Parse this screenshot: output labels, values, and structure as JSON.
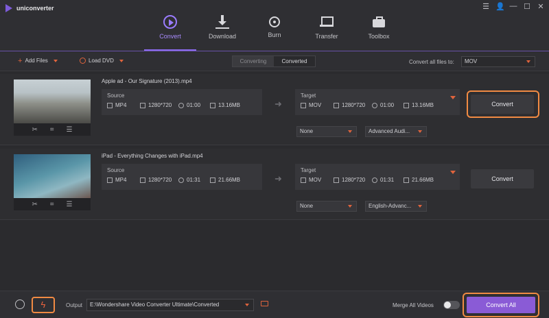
{
  "app": {
    "title": "uniconverter"
  },
  "window_controls": [
    "☰",
    "👤",
    "—",
    "☐",
    "✕"
  ],
  "nav": [
    {
      "label": "Convert",
      "icon": "convert-icon",
      "active": true
    },
    {
      "label": "Download",
      "icon": "download-icon"
    },
    {
      "label": "Burn",
      "icon": "burn-icon"
    },
    {
      "label": "Transfer",
      "icon": "transfer-icon"
    },
    {
      "label": "Toolbox",
      "icon": "toolbox-icon"
    }
  ],
  "toolbar": {
    "add_files": "Add Files",
    "load_dvd": "Load DVD",
    "tab_converting": "Converting",
    "tab_converted": "Converted",
    "convert_all_to_label": "Convert all files to:",
    "convert_all_to_value": "MOV"
  },
  "files": [
    {
      "name": "Apple ad - Our Signature (2013).mp4",
      "source": {
        "title": "Source",
        "format": "MP4",
        "resolution": "1280*720",
        "duration": "01:00",
        "size": "13.16MB"
      },
      "target": {
        "title": "Target",
        "format": "MOV",
        "resolution": "1280*720",
        "duration": "01:00",
        "size": "13.16MB"
      },
      "subtitle": "None",
      "audio": "Advanced Audi...",
      "convert_label": "Convert"
    },
    {
      "name": "iPad - Everything Changes with iPad.mp4",
      "source": {
        "title": "Source",
        "format": "MP4",
        "resolution": "1280*720",
        "duration": "01:31",
        "size": "21.66MB"
      },
      "target": {
        "title": "Target",
        "format": "MOV",
        "resolution": "1280*720",
        "duration": "01:31",
        "size": "21.66MB"
      },
      "subtitle": "None",
      "audio": "English-Advanc...",
      "convert_label": "Convert"
    }
  ],
  "bottom": {
    "output_label": "Output",
    "output_path": "E:\\Wondershare Video Converter Ultimate\\Converted",
    "merge_label": "Merge All Videos",
    "convert_all": "Convert All"
  },
  "colors": {
    "accent": "#8d6cf0",
    "highlight": "#f28b43",
    "orange_icon": "#e0643d"
  }
}
